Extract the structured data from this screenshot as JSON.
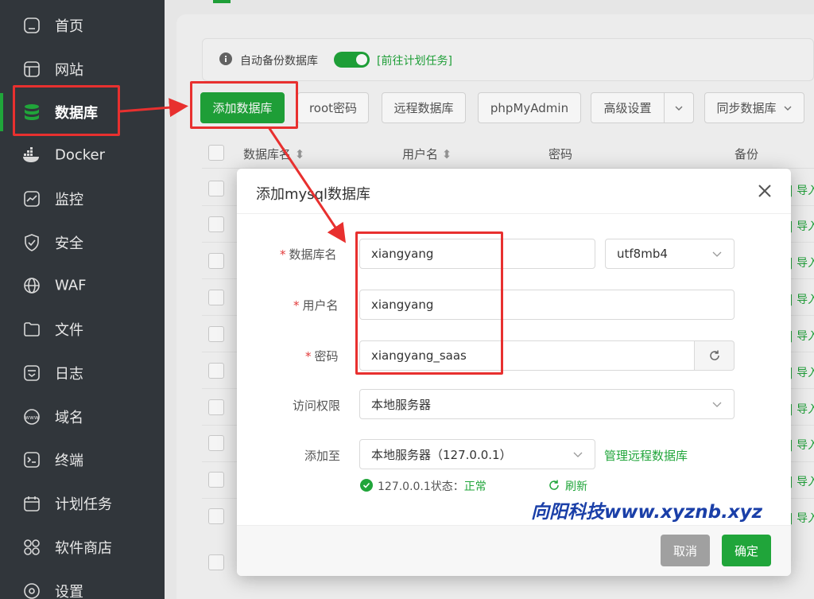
{
  "sidebar": {
    "items": [
      {
        "label": "首页",
        "icon": "home-icon"
      },
      {
        "label": "网站",
        "icon": "website-icon"
      },
      {
        "label": "数据库",
        "icon": "database-icon"
      },
      {
        "label": "Docker",
        "icon": "docker-icon"
      },
      {
        "label": "监控",
        "icon": "monitor-icon"
      },
      {
        "label": "安全",
        "icon": "shield-icon"
      },
      {
        "label": "WAF",
        "icon": "globe-icon"
      },
      {
        "label": "文件",
        "icon": "folder-icon"
      },
      {
        "label": "日志",
        "icon": "log-icon"
      },
      {
        "label": "域名",
        "icon": "www-icon"
      },
      {
        "label": "终端",
        "icon": "terminal-icon"
      },
      {
        "label": "计划任务",
        "icon": "calendar-icon"
      },
      {
        "label": "软件商店",
        "icon": "apps-icon"
      },
      {
        "label": "设置",
        "icon": "gear-icon"
      }
    ],
    "active": "数据库"
  },
  "toolbar": {
    "auto_backup_label": "自动备份数据库",
    "auto_backup_on": true,
    "go_task_link": "[前往计划任务]",
    "add_db": "添加数据库",
    "root_pwd": "root密码",
    "remote_db": "远程数据库",
    "phpmyadmin": "phpMyAdmin",
    "advanced": "高级设置",
    "sync_db": "同步数据库"
  },
  "table": {
    "headers": {
      "name": "数据库名",
      "user": "用户名",
      "password": "密码",
      "backup": "备份"
    },
    "row_link": "导入"
  },
  "dialog": {
    "title": "添加mysql数据库",
    "db_name_label": "数据库名",
    "db_name_value": "xiangyang",
    "charset_value": "utf8mb4",
    "user_label": "用户名",
    "user_value": "xiangyang",
    "password_label": "密码",
    "password_value": "xiangyang_saas",
    "access_label": "访问权限",
    "access_value": "本地服务器",
    "add_to_label": "添加至",
    "add_to_value": "本地服务器（127.0.0.1）",
    "manage_remote_link": "管理远程数据库",
    "status_text": "127.0.0.1状态：",
    "status_value": "正常",
    "refresh": "刷新",
    "cancel": "取消",
    "confirm": "确定"
  },
  "watermark": "向阳科技www.xyznb.xyz",
  "colors": {
    "brand_green": "#20a53a",
    "sidebar_bg": "#31363b",
    "highlight_red": "#e8302f",
    "watermark_blue": "#1a3fa8"
  }
}
